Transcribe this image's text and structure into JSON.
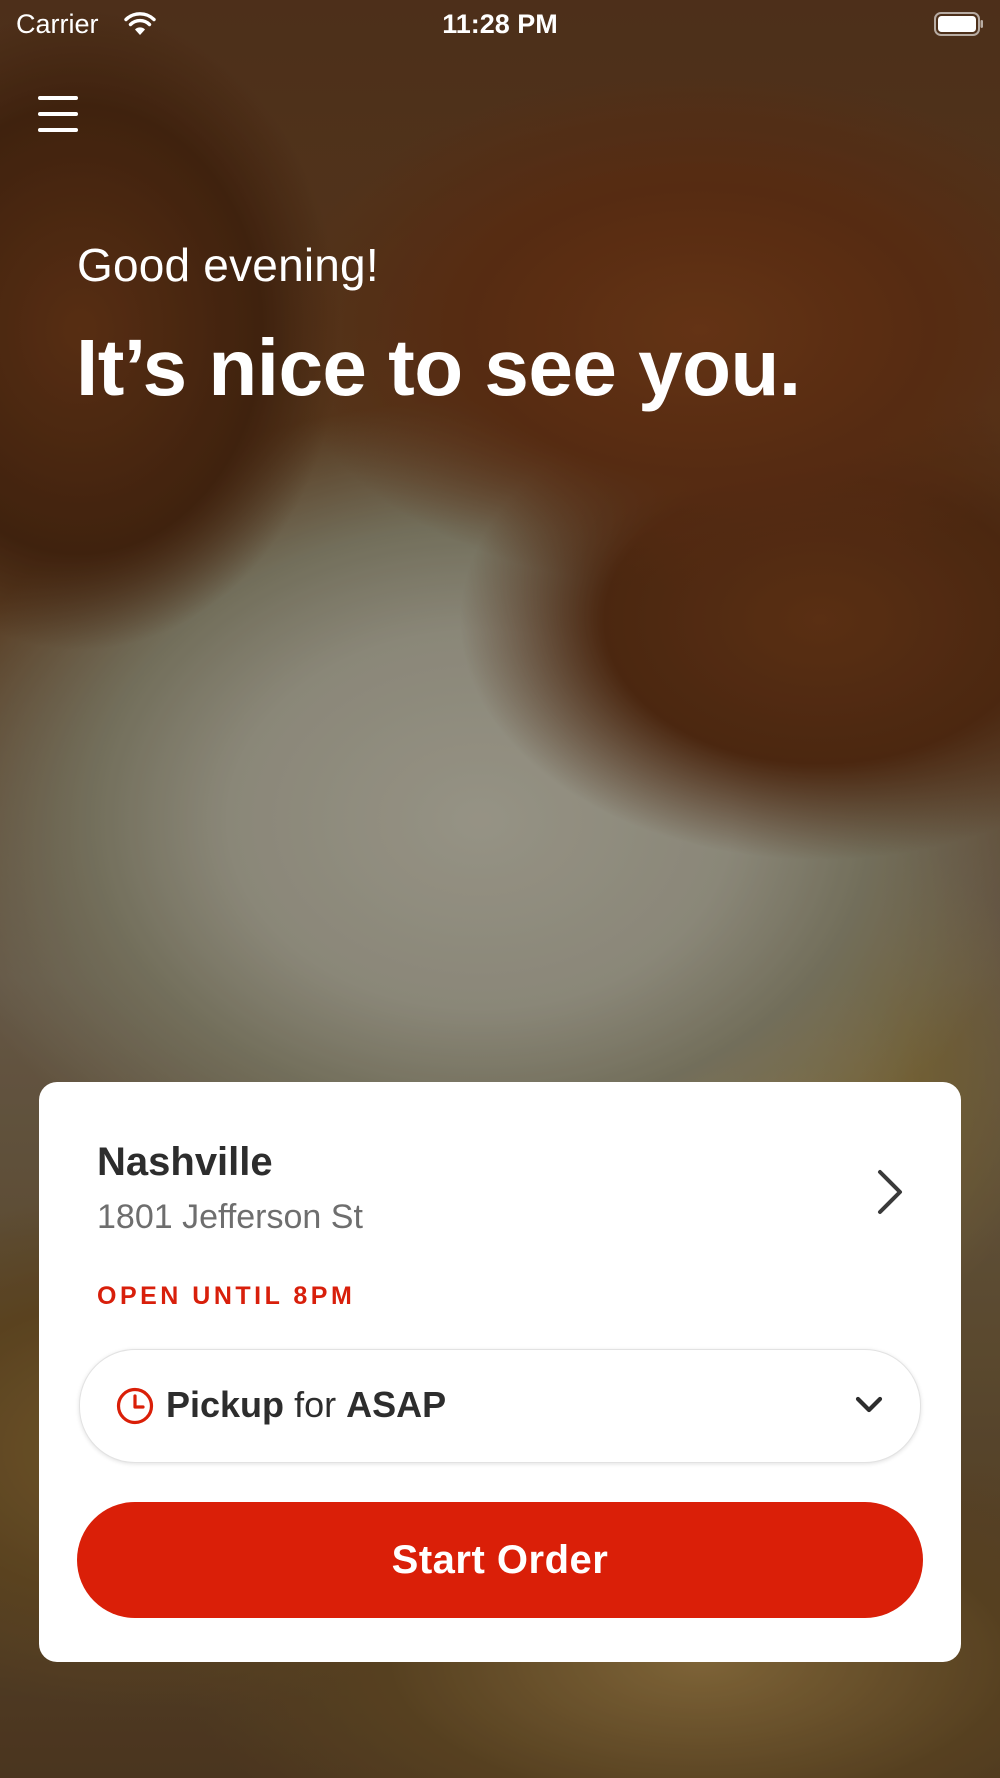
{
  "status_bar": {
    "carrier": "Carrier",
    "time": "11:28 PM",
    "wifi_icon": "wifi-icon",
    "battery_icon": "battery-full-icon"
  },
  "header": {
    "menu_icon": "hamburger-menu-icon"
  },
  "hero": {
    "greeting": "Good evening!",
    "headline": "It’s nice to see you."
  },
  "location": {
    "name": "Nashville",
    "address": "1801 Jefferson St",
    "status": "OPEN UNTIL 8PM",
    "chevron_icon": "chevron-right-icon"
  },
  "order_mode": {
    "icon": "clock-icon",
    "mode": "Pickup",
    "connector": "for",
    "time": "ASAP",
    "dropdown_icon": "chevron-down-icon"
  },
  "actions": {
    "start_order_label": "Start Order"
  },
  "colors": {
    "accent": "#da1f08",
    "text_dark": "#2d2d2d",
    "text_muted": "#6e6e6e",
    "card_bg": "#ffffff"
  }
}
